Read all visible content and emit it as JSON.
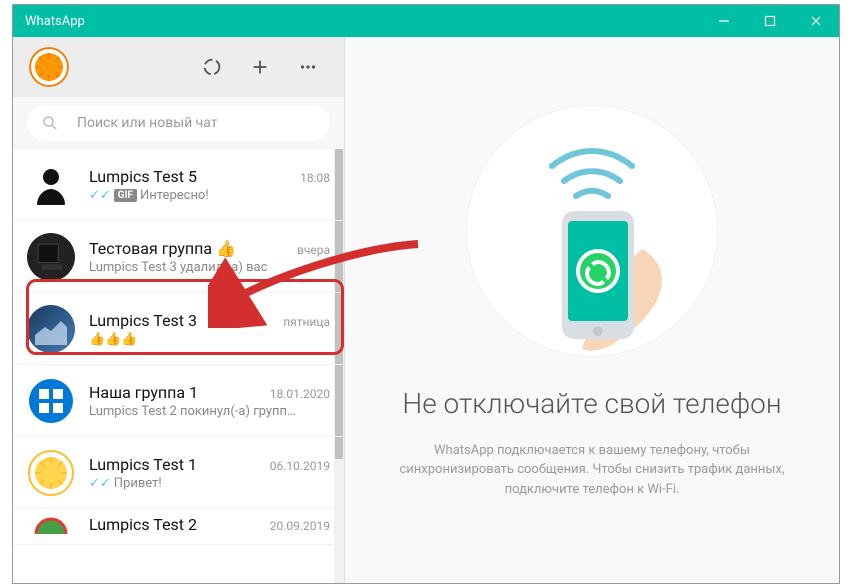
{
  "window": {
    "title": "WhatsApp"
  },
  "search": {
    "placeholder": "Поиск или новый чат"
  },
  "chats": [
    {
      "name": "Lumpics Test 5",
      "time": "18:08",
      "preview": "Интересно!",
      "show_checks": true,
      "show_gif": true
    },
    {
      "name": "Тестовая группа 👍",
      "time": "вчера",
      "preview": "Lumpics Test 3 удалил(-а) вас",
      "show_checks": false,
      "show_gif": false
    },
    {
      "name": "Lumpics Test 3",
      "time": "пятница",
      "preview": "👍👍👍",
      "show_checks": false,
      "show_gif": false
    },
    {
      "name": "Наша группа 1",
      "time": "18.01.2020",
      "preview": "Lumpics Test 2 покинул(-а) групп…",
      "show_checks": false,
      "show_gif": false
    },
    {
      "name": "Lumpics Test 1",
      "time": "06.10.2019",
      "preview": "Привет!",
      "show_checks": true,
      "show_gif": false
    },
    {
      "name": "Lumpics Test 2",
      "time": "20.09.2019",
      "preview": "",
      "show_checks": false,
      "show_gif": false
    }
  ],
  "main": {
    "title": "Не отключайте свой телефон",
    "subtitle": "WhatsApp подключается к вашему телефону, чтобы синхронизировать сообщения. Чтобы снизить трафик данных, подключите телефон к Wi-Fi."
  },
  "badges": {
    "gif": "GIF"
  }
}
